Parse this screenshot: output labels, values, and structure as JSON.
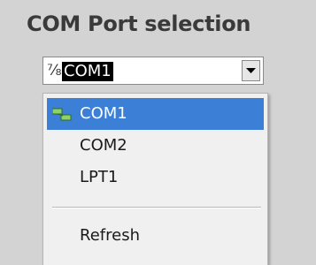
{
  "header": {
    "title": "COM Port selection"
  },
  "combo": {
    "value": "COM1",
    "icon": "io-icon",
    "dropdown_icon": "chevron-down-icon"
  },
  "menu": {
    "items": [
      {
        "label": "COM1",
        "selected": true,
        "icon": "serial-port-icon"
      },
      {
        "label": "COM2",
        "selected": false
      },
      {
        "label": "LPT1",
        "selected": false
      }
    ],
    "refresh_label": "Refresh"
  },
  "colors": {
    "selection": "#3c7fd6",
    "background": "#d3d3d3",
    "title": "#3a3a3a"
  }
}
